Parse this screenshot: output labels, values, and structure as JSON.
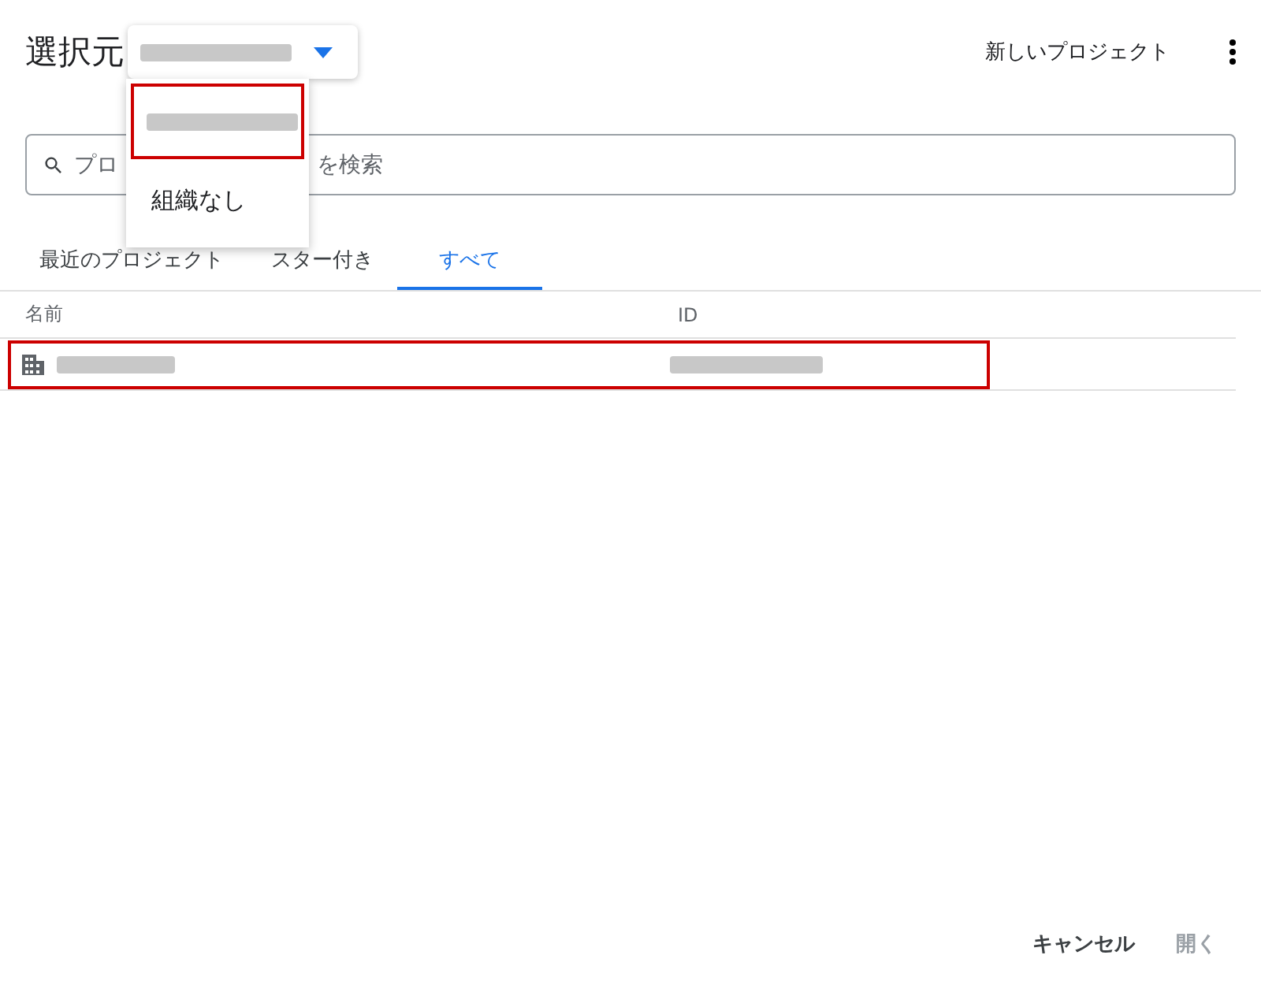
{
  "header": {
    "title": "選択元",
    "org_selector": {
      "value_redacted": true,
      "expanded": true
    },
    "new_project": "新しいプロジェクト"
  },
  "org_menu": {
    "items": [
      {
        "redacted": true,
        "highlighted": true
      },
      {
        "label": "組織なし",
        "redacted": false,
        "highlighted": false
      }
    ]
  },
  "search": {
    "placeholder_start": "プロ",
    "placeholder_end": "を検索"
  },
  "tabs": [
    {
      "label": "最近のプロジェクト",
      "selected": false
    },
    {
      "label": "スター付き",
      "selected": false
    },
    {
      "label": "すべて",
      "selected": true
    }
  ],
  "table": {
    "columns": [
      "名前",
      "ID"
    ],
    "rows": [
      {
        "name_redacted": true,
        "id_redacted": true,
        "highlighted": true
      }
    ]
  },
  "buttons": [
    {
      "label": "キャンセル",
      "disabled": false
    },
    {
      "label": "開く",
      "disabled": true
    }
  ]
}
